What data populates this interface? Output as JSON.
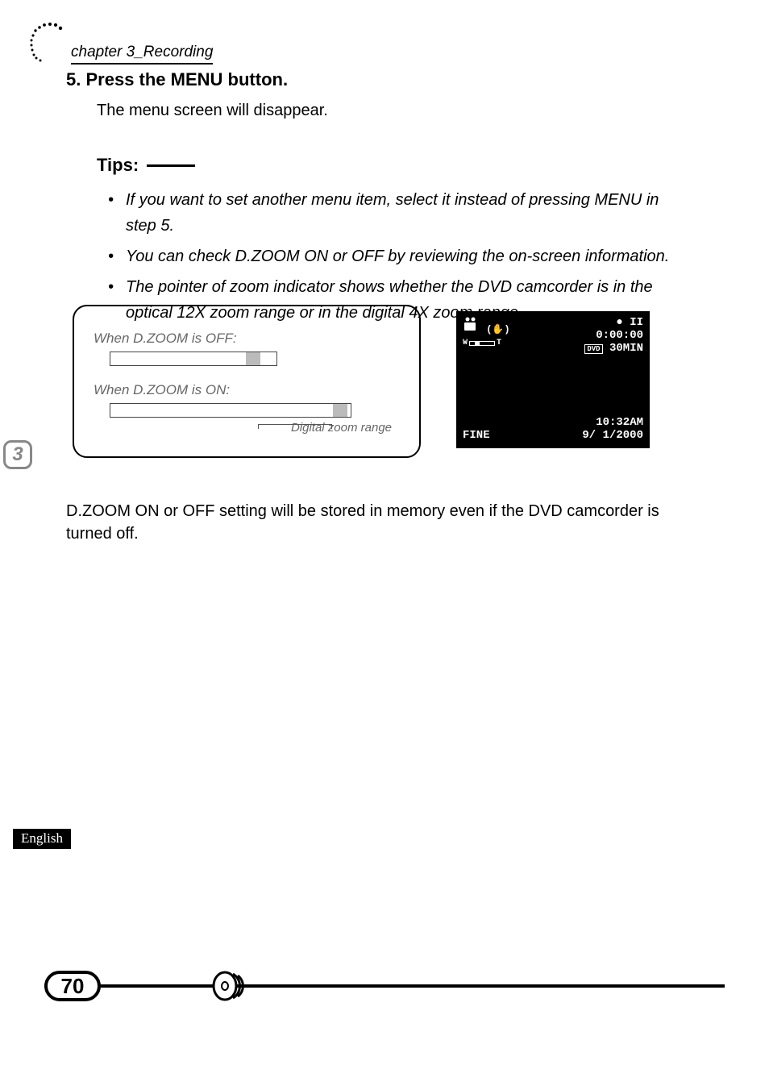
{
  "chapter": {
    "label": "chapter 3_Recording",
    "tab_number": "3"
  },
  "step": {
    "number": "5.",
    "title": "Press the MENU button.",
    "description": "The menu screen will disappear."
  },
  "tips": {
    "heading": "Tips:",
    "items": [
      "If you want to set another menu item, select it instead of pressing MENU in step 5.",
      "You can check D.ZOOM ON or OFF by reviewing the on-screen information.",
      "The pointer of zoom indicator shows whether the DVD camcorder is in the optical 12X zoom range or in the digital 4X zoom range."
    ]
  },
  "diagram": {
    "off_label": "When D.ZOOM is OFF:",
    "on_label": "When D.ZOOM is ON:",
    "digital_label": "Digital zoom range"
  },
  "screen": {
    "zoom_w": "W",
    "zoom_t": "T",
    "rec_pause": "● II",
    "timer": "0:00:00",
    "dvd": "DVD",
    "remain": "30MIN",
    "quality": "FINE",
    "time": "10:32AM",
    "date": "9/ 1/2000"
  },
  "body_paragraph": "D.ZOOM ON or OFF setting will be stored in memory even if the DVD camcorder is turned off.",
  "language": "English",
  "page_number": "70"
}
